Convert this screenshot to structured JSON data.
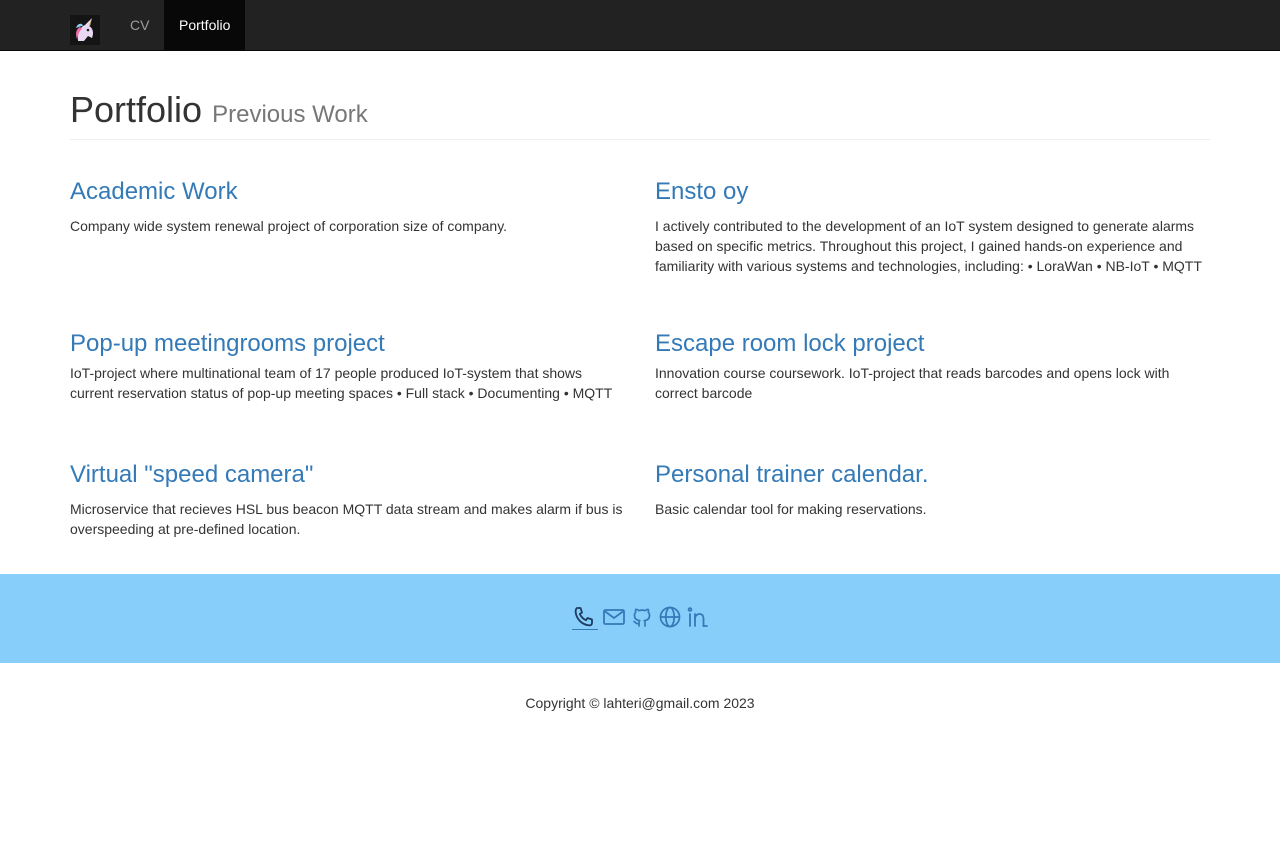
{
  "nav": {
    "logo_icon": "unicorn-logo",
    "items": [
      {
        "label": "CV",
        "active": false
      },
      {
        "label": "Portfolio",
        "active": true
      }
    ]
  },
  "header": {
    "title": "Portfolio",
    "subtitle": "Previous Work"
  },
  "projects": [
    {
      "title": "Academic Work",
      "description": "Company wide system renewal project of corporation size of company."
    },
    {
      "title": "Ensto oy",
      "description": "I actively contributed to the development of an IoT system designed to generate alarms based on specific metrics. Throughout this project, I gained hands-on experience and familiarity with various systems and technologies, including: • LoraWan • NB-IoT • MQTT"
    },
    {
      "title": "Pop-up meetingrooms project",
      "description": "IoT-project where multinational team of 17 people produced IoT-system that shows current reservation status of pop-up meeting spaces • Full stack • Documenting • MQTT"
    },
    {
      "title": "Escape room lock project",
      "description": "Innovation course coursework. IoT-project that reads barcodes and opens lock with correct barcode"
    },
    {
      "title": "Virtual \"speed camera\"",
      "description": "Microservice that recieves HSL bus beacon MQTT data stream and makes alarm if bus is overspeeding at pre-defined location."
    },
    {
      "title": "Personal trainer calendar.",
      "description": "Basic calendar tool for making reservations."
    }
  ],
  "contact": {
    "icons": [
      "phone-icon",
      "mail-icon",
      "github-icon",
      "globe-icon",
      "linkedin-icon"
    ]
  },
  "footer": {
    "copyright": "Copyright © lahteri@gmail.com 2023"
  },
  "colors": {
    "navbar_bg": "#222222",
    "link": "#337ab7",
    "contact_bar": "#87cefa"
  }
}
